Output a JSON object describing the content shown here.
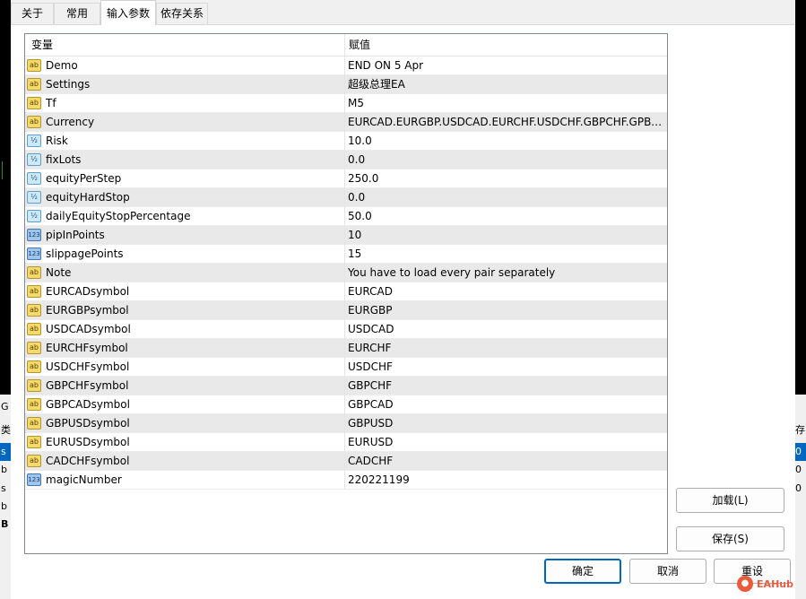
{
  "tabs": [
    {
      "label": "关于",
      "active": false
    },
    {
      "label": "常用",
      "active": false
    },
    {
      "label": "输入参数",
      "active": true
    },
    {
      "label": "依存关系",
      "active": false
    }
  ],
  "table": {
    "headers": {
      "variable": "变量",
      "value": "赋值"
    },
    "rows": [
      {
        "type": "string",
        "icon_text": "ab",
        "name": "Demo",
        "value": "END ON 5 Apr"
      },
      {
        "type": "string",
        "icon_text": "ab",
        "name": "Settings",
        "value": "超级总理EA"
      },
      {
        "type": "string",
        "icon_text": "ab",
        "name": "Tf",
        "value": "M5"
      },
      {
        "type": "string",
        "icon_text": "ab",
        "name": "Currency",
        "value": "EURCAD.EURGBP.USDCAD.EURCHF.USDCHF.GBPCHF.GPBC..."
      },
      {
        "type": "double",
        "icon_text": "½",
        "name": "Risk",
        "value": "10.0"
      },
      {
        "type": "double",
        "icon_text": "½",
        "name": "fixLots",
        "value": "0.0"
      },
      {
        "type": "double",
        "icon_text": "½",
        "name": "equityPerStep",
        "value": "250.0"
      },
      {
        "type": "double",
        "icon_text": "½",
        "name": "equityHardStop",
        "value": "0.0"
      },
      {
        "type": "double",
        "icon_text": "½",
        "name": "dailyEquityStopPercentage",
        "value": "50.0"
      },
      {
        "type": "int",
        "icon_text": "123",
        "name": "pipInPoints",
        "value": "10"
      },
      {
        "type": "int",
        "icon_text": "123",
        "name": "slippagePoints",
        "value": "15"
      },
      {
        "type": "string",
        "icon_text": "ab",
        "name": "Note",
        "value": "You have to load every pair separately"
      },
      {
        "type": "string",
        "icon_text": "ab",
        "name": "EURCADsymbol",
        "value": "EURCAD"
      },
      {
        "type": "string",
        "icon_text": "ab",
        "name": "EURGBPsymbol",
        "value": "EURGBP"
      },
      {
        "type": "string",
        "icon_text": "ab",
        "name": "USDCADsymbol",
        "value": "USDCAD"
      },
      {
        "type": "string",
        "icon_text": "ab",
        "name": "EURCHFsymbol",
        "value": "EURCHF"
      },
      {
        "type": "string",
        "icon_text": "ab",
        "name": "USDCHFsymbol",
        "value": "USDCHF"
      },
      {
        "type": "string",
        "icon_text": "ab",
        "name": "GBPCHFsymbol",
        "value": "GBPCHF"
      },
      {
        "type": "string",
        "icon_text": "ab",
        "name": "GBPCADsymbol",
        "value": "GBPCAD"
      },
      {
        "type": "string",
        "icon_text": "ab",
        "name": "GBPUSDsymbol",
        "value": "GBPUSD"
      },
      {
        "type": "string",
        "icon_text": "ab",
        "name": "EURUSDsymbol",
        "value": "EURUSD"
      },
      {
        "type": "string",
        "icon_text": "ab",
        "name": "CADCHFsymbol",
        "value": "CADCHF"
      },
      {
        "type": "int",
        "icon_text": "123",
        "name": "magicNumber",
        "value": "220221199"
      }
    ]
  },
  "buttons": {
    "load": "加载(L)",
    "save": "保存(S)",
    "ok": "确定",
    "cancel": "取消",
    "reset": "重设"
  },
  "watermark": {
    "text": "EAHub"
  },
  "background": {
    "left_labels": [
      "G",
      "类",
      "s",
      "b",
      "s",
      "b",
      "B"
    ],
    "right_labels": [
      "存",
      "0",
      "0",
      "0"
    ]
  },
  "colors": {
    "accent": "#0067c0",
    "row_alt": "#e9e9e9",
    "watermark": "#ea5a3d"
  }
}
